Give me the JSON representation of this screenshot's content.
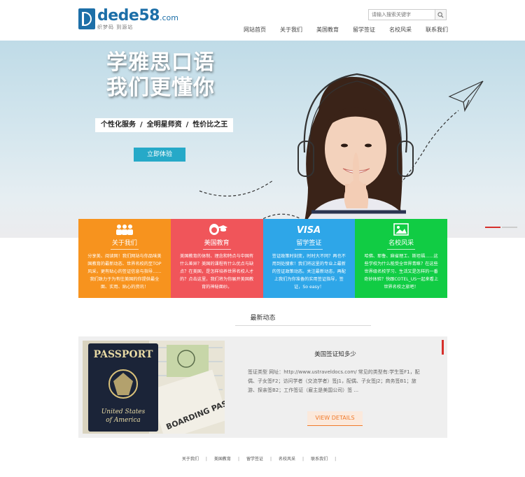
{
  "logo": {
    "main": "dede58",
    "suffix": ".com",
    "slogan": "织梦码 到源站"
  },
  "search": {
    "placeholder": "请输入搜索关键字"
  },
  "nav": {
    "items": [
      "网站首页",
      "关于我们",
      "美国教育",
      "留学签证",
      "名校风采",
      "联系我们"
    ]
  },
  "hero": {
    "title_line1": "学雅思口语",
    "title_line2": "我们更懂你",
    "tag1": "个性化服务",
    "tag2": "全明星师资",
    "tag3": "性价比之王",
    "sep": "/",
    "button": "立即体验"
  },
  "features": [
    {
      "title": "关于我们",
      "color": "#f7931e",
      "icon": "people-icon",
      "desc": "分享美、阅读网！我们网站与你品味美国教育的最新动态、世界名校的至TOP风采，更有贴心的签证信息与指导……我们致力于为有往美国的你提供最全面、实用、贴心的资讯！"
    },
    {
      "title": "美国教育",
      "color": "#f0555a",
      "icon": "graduate-icon",
      "desc": "美国教育的体制、理念和特点与中国有什么差异？美国的课程有什么优点与缺点？在美国，是怎样培养世界名校人才的？点击这里，我们将为你展开美国教育的神秘面纱。"
    },
    {
      "title": "留学签证",
      "color": "#2ea6e8",
      "icon": "visa-icon",
      "desc": "签证政策时刻变，时时大不同？再也不用到处搜索！我们将这里的专业上最新的签证政策动态。关注最新动态，再配上我们为你准备的实用签证指导，签证，So easy！"
    },
    {
      "title": "名校风采",
      "color": "#11cc44",
      "icon": "picture-icon",
      "desc": "哈佛、耶鲁、麻省理工、斯坦福……这些学校为什么能受全世界青睐？在这些世界级名校学习、生活又是怎样的一番奇妙体验？快跟COTEL_US一起来看上世界名校之旅吧！"
    }
  ],
  "news": {
    "heading": "最新动态",
    "title": "美国签证知多少",
    "body": "签证类型 网址：http://www.ustraveldocs.com/ 常见的类型有:学生签F1，配偶、子女签F2；访问学者（交流学者）签J1，配偶、子女签J2；商务签B1；旅游、探亲签B2；工作签证（雇主是美国公司）签 ...",
    "button": "VIEW DETAILS",
    "image_text": {
      "passport": "PASSPORT",
      "country": "United States of America",
      "boarding": "BOARDING PASS"
    }
  },
  "footer": {
    "links": [
      "关于我们",
      "美国教育",
      "留学签证",
      "名校风采",
      "联系我们"
    ],
    "sep": "|"
  },
  "colors": {
    "accent": "#26a9c8",
    "brand": "#1d6fa8",
    "orange": "#f07a2a",
    "red": "#d6302c"
  }
}
